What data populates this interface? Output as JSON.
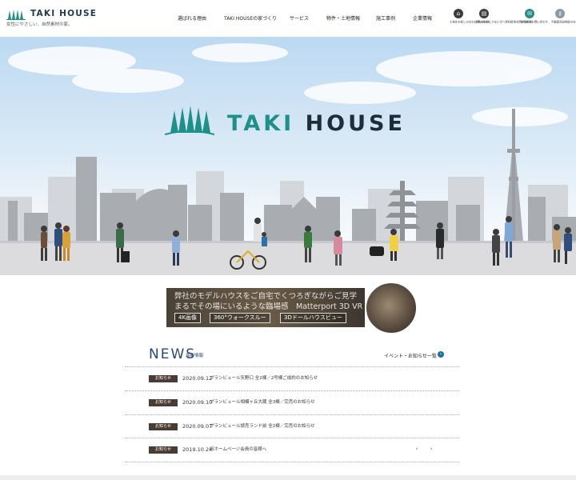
{
  "header": {
    "logo_name": "TAKI HOUSE",
    "logo_tagline": "女性にやさしい、自然素材の家。",
    "nav": [
      "選ばれる理由",
      "TAKI HOUSEの家づくり",
      "サービス",
      "物件・土地情報",
      "施工事例",
      "企業情報"
    ],
    "buttons": [
      {
        "label": "土地をお探しの方のお問い合わせ",
        "icon": "house-icon",
        "color": "#3c3c3c"
      },
      {
        "label": "土地をお探しでない方へ資料請求お問い合わせ",
        "icon": "document-icon",
        "color": "#3c3c3c"
      },
      {
        "label": "資料請求お問い合わせ",
        "icon": "mail-icon",
        "color": "#2a8c86"
      },
      {
        "label": "不動産売却相談のお申し込み",
        "icon": "key-icon",
        "color": "#8a9aa6"
      }
    ]
  },
  "hero": {
    "title_accent": "TAKI",
    "title_rest": " HOUSE"
  },
  "vr_banner": {
    "line1": "弊社のモデルハウスをご自宅でくつろぎながらご見学",
    "line2": "まるでその場にいるような臨場感　Matterport 3D VR",
    "tags": [
      "4K画像",
      "360°ウォークスルー",
      "3Dドールハウスビュー"
    ]
  },
  "news": {
    "title": "NEWS",
    "subtitle": "最新情報",
    "more_label": "イベント・お知らせ一覧",
    "items": [
      {
        "tag": "お知らせ",
        "date": "2020.09.12",
        "text": "プランビュール矢野口 全2棟／2号棟ご成約のお知らせ"
      },
      {
        "tag": "お知らせ",
        "date": "2020.09.10",
        "text": "プランビュール相模ヶ丘大蔵 全3棟／完売のお知らせ"
      },
      {
        "tag": "お知らせ",
        "date": "2020.09.07",
        "text": "プランビュール読売ランド前 全2棟／完売のお知らせ"
      },
      {
        "tag": "お知らせ",
        "date": "2019.10.24",
        "text": "旧ホームページ会員の皆様へ"
      }
    ],
    "pager_prev": "‹",
    "pager_next": "›"
  },
  "colors": {
    "brand_teal": "#1f8f8a",
    "brand_dark": "#1e2d38",
    "news_tag_bg": "#4a3c32"
  }
}
